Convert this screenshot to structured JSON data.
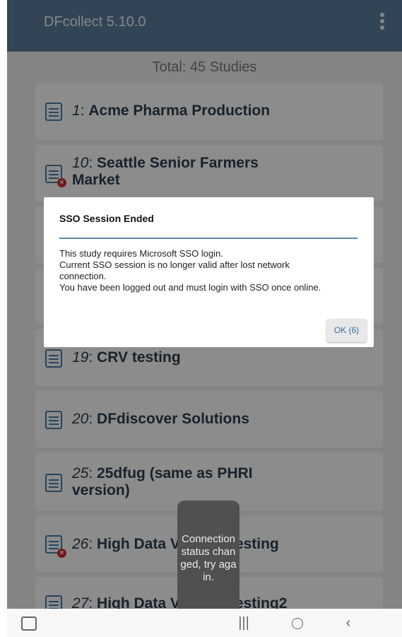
{
  "app": {
    "title": "DFcollect 5.10.0"
  },
  "summary": {
    "total": "Total: 45 Studies"
  },
  "studies": [
    {
      "num": "1",
      "name": "Acme Pharma Production",
      "error": false
    },
    {
      "num": "10",
      "name": "Seattle Senior Farmers",
      "name2": "Market",
      "error": true
    },
    {
      "num": "19",
      "name": "CRV testing",
      "error": false
    },
    {
      "num": "20",
      "name": "DFdiscover Solutions",
      "error": false
    },
    {
      "num": "25",
      "name": "25dfug (same as PHRI",
      "name2": "version)",
      "error": false
    },
    {
      "num": "26",
      "name": "High Data V",
      "name_tail": "esting",
      "error": true
    },
    {
      "num": "27",
      "name": "High Data V",
      "name_tail": "esting2",
      "error": true
    }
  ],
  "dialog": {
    "title": "SSO Session Ended",
    "lines": [
      "This study requires Microsoft SSO login.",
      "Current SSO session is no longer valid after lost network",
      "connection.",
      "You have been logged out and must login with SSO once online."
    ],
    "ok_label": "OK (6)"
  },
  "toast": {
    "text": "Connection status changed, try again."
  },
  "icons": {
    "menu": "overflow-menu-icon",
    "study": "study-list-icon",
    "error": "error-badge-icon",
    "keyboard": "keyboard-icon",
    "recents": "recents-icon",
    "home": "home-icon",
    "back": "back-icon"
  },
  "colors": {
    "appbar": "#5b7f9d",
    "accent": "#4a7fb0",
    "error": "#d62c2c",
    "ok_text": "#3a6ea0"
  }
}
